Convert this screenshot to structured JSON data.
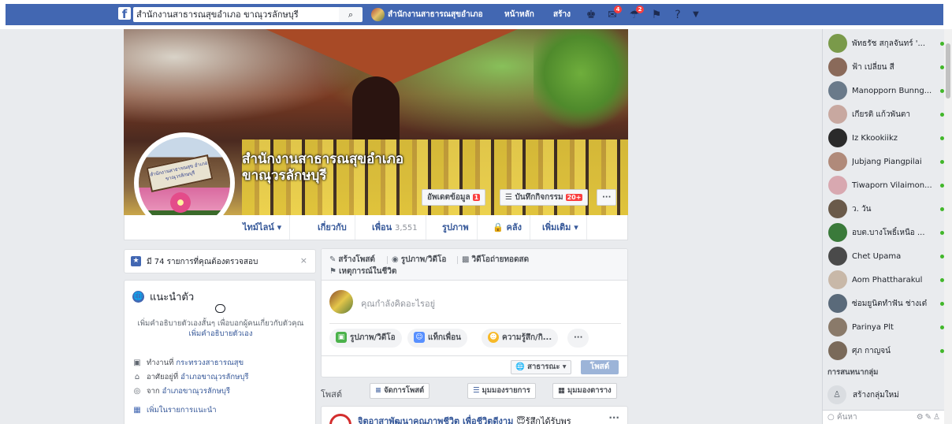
{
  "topbar": {
    "logo": "f",
    "search_value": "สำนักงานสาธารณสุขอำเภอ ขาณุวรลักษบุรี",
    "search_icon": "⌕",
    "page_name": "สำนักงานสาธารณสุขอำเภอ",
    "nav_home": "หน้าหลัก",
    "nav_create": "สร้าง",
    "badge_messages": "4",
    "badge_notifications": "2",
    "icons": {
      "friends": "friend-requests-icon",
      "messages": "messenger-icon",
      "notifications": "notifications-icon",
      "quick_help": "quick-help-icon",
      "help": "help-icon",
      "menu": "account-menu-icon"
    }
  },
  "cover": {
    "page_title": "สำนักงานสาธารณสุขอำเภอขาณุวรลักษบุรี",
    "update_info": "อัพเดตข้อมูล",
    "update_badge": "1",
    "activity_log": "บันทึกกิจกรรม",
    "activity_badge": "20+",
    "more": "···",
    "sign_text": "สำนักงานสาธารณสุข อำเภอขาณุวรลักษบุรี"
  },
  "nav_tabs": {
    "timeline": "ไทม์ไลน์ ▾",
    "about": "เกี่ยวกับ",
    "friends": "เพื่อน",
    "friends_count": "3,551",
    "photos": "รูปภาพ",
    "archive": "คลัง",
    "more": "เพิ่มเติม ▾"
  },
  "review_notice": {
    "text": "มี 74 รายการที่คุณต้องตรวจสอบ",
    "close": "×"
  },
  "intro": {
    "title": "แนะนำตัว",
    "desc": "เพิ่มคำอธิบายตัวเองสั้นๆ เพื่อบอกผู้คนเกี่ยวกับตัวคุณ",
    "add_bio": "เพิ่มคำอธิบายตัวเอง",
    "work_prefix": "ทำงานที่",
    "work_link": "กระทรวงสาธารณสุข",
    "lives_prefix": "อาศัยอยู่ที่",
    "lives_link": "อำเภอขาณุวรลักษบุรี",
    "from_prefix": "จาก",
    "from_link": "อำเภอขาณุวรลักษบุรี",
    "featured": "เพิ่มในรายการแนะนำ"
  },
  "composer": {
    "tab_create": "สร้างโพสต์",
    "tab_photo": "รูปภาพ/วิดีโอ",
    "tab_live": "วิดีโอถ่ายทอดสด",
    "tab_event": "เหตุการณ์ในชีวิต",
    "placeholder": "คุณกำลังคิดอะไรอยู่",
    "pill_photo": "รูปภาพ/วิดีโอ",
    "pill_tag": "แท็กเพื่อน",
    "pill_feeling": "ความรู้สึก/กิ...",
    "pill_more": "···",
    "audience": "สาธารณะ ▾",
    "post": "โพสต์"
  },
  "posts_bar": {
    "label": "โพสต์",
    "manage": "จัดการโพสต์",
    "list_view": "มุมมองรายการ",
    "grid_view": "มุมมองตาราง"
  },
  "feed_post": {
    "title": "จิตอาสาพัฒนาคุณภาพชีวิต เพื่อชีวิตดีงาม",
    "suffix": "😇รู้สึกได้รับพร",
    "more": "···"
  },
  "chat": {
    "contacts": [
      {
        "name": "พัทธรัช สกุลจันทร์ '...",
        "color": "#7a9a4a"
      },
      {
        "name": "ฟ้า เปลี่ยน สี",
        "color": "#8a6a5a"
      },
      {
        "name": "Manopporn Bunng...",
        "color": "#6a7a8a"
      },
      {
        "name": "เกียรติ แก้วพันตา",
        "color": "#c8a8a0"
      },
      {
        "name": "Iz Kkookiikz",
        "color": "#2a2a2a"
      },
      {
        "name": "Jubjang Piangpilai",
        "color": "#b08a7a"
      },
      {
        "name": "Tiwaporn Vilaimon...",
        "color": "#d8a8b0"
      },
      {
        "name": "ว. วัน",
        "color": "#6a5a4a"
      },
      {
        "name": "อบต.บางโพธิ์เหนือ ...",
        "color": "#3a7a3a"
      },
      {
        "name": "Chet Upama",
        "color": "#4a4a4a"
      },
      {
        "name": "Aom Phattharakul",
        "color": "#c8b8a8"
      },
      {
        "name": "ซ่อมยูนิตทำฟัน ช่างเต๋",
        "color": "#5a6a7a"
      },
      {
        "name": "Parinya Plt",
        "color": "#8a7a6a"
      },
      {
        "name": "ศุภ กาญจน์",
        "color": "#7a6a5a"
      }
    ],
    "section": "การสนทนากลุ่ม",
    "new_group": "สร้างกลุ่มใหม่",
    "search_placeholder": "ค้นหา"
  },
  "colors": {
    "brand_blue": "#4267b2",
    "link_blue": "#365899",
    "online_green": "#42b72a",
    "badge_red": "#fa3e3e"
  }
}
